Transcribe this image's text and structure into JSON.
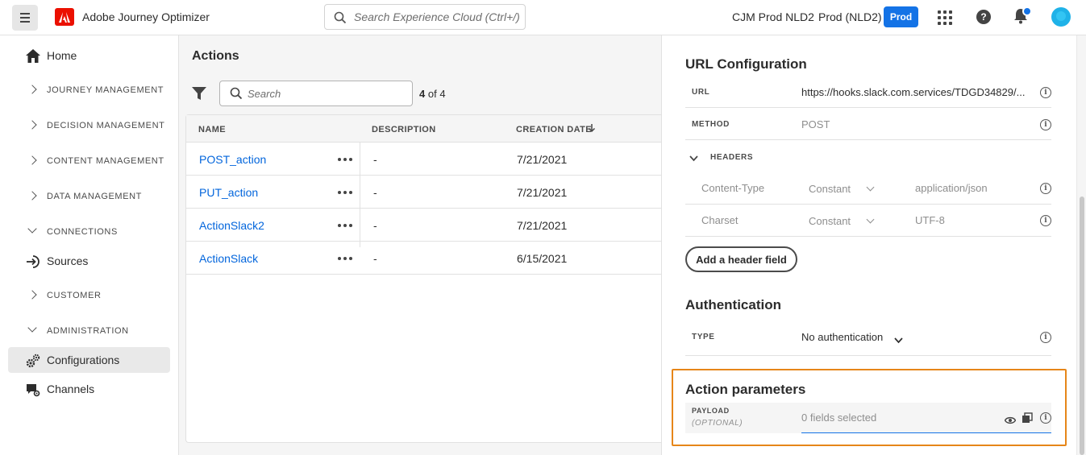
{
  "topbar": {
    "app_title": "Adobe Journey Optimizer",
    "search_placeholder": "Search Experience Cloud (Ctrl+/)",
    "org": "CJM Prod NLD2",
    "sandbox": "Prod (NLD2)",
    "env_badge": "Prod",
    "accent": "#1473e6",
    "brand": "#eb1000",
    "notification_badge": true
  },
  "sidebar": {
    "home": "Home",
    "journey_management": "JOURNEY MANAGEMENT",
    "decision_management": "DECISION MANAGEMENT",
    "content_management": "CONTENT MANAGEMENT",
    "data_management": "DATA MANAGEMENT",
    "connections": "CONNECTIONS",
    "sources": "Sources",
    "customer": "CUSTOMER",
    "administration": "ADMINISTRATION",
    "configurations": "Configurations",
    "channels": "Channels"
  },
  "list": {
    "title": "Actions",
    "search_placeholder": "Search",
    "count_current": "4",
    "count_label": "of 4",
    "columns": {
      "name": "NAME",
      "description": "DESCRIPTION",
      "creation_date": "CREATION DATE"
    },
    "rows": [
      {
        "name": "POST_action",
        "description": "-",
        "date": "7/21/2021"
      },
      {
        "name": "PUT_action",
        "description": "-",
        "date": "7/21/2021"
      },
      {
        "name": "ActionSlack2",
        "description": "-",
        "date": "7/21/2021"
      },
      {
        "name": "ActionSlack",
        "description": "-",
        "date": "6/15/2021"
      }
    ]
  },
  "panel": {
    "url_config_title": "URL Configuration",
    "url_label": "URL",
    "url_value": "https://hooks.slack.com.services/TDGD34829/...",
    "method_label": "METHOD",
    "method_value": "POST",
    "headers_label": "HEADERS",
    "headers": [
      {
        "name": "Content-Type",
        "type": "Constant",
        "value": "application/json"
      },
      {
        "name": "Charset",
        "type": "Constant",
        "value": "UTF-8"
      }
    ],
    "add_header_button": "Add a header field",
    "auth_title": "Authentication",
    "auth_type_label": "TYPE",
    "auth_type_value": "No authentication",
    "params_title": "Action parameters",
    "payload_label": "PAYLOAD",
    "payload_optional": "(OPTIONAL)",
    "payload_value": "0 fields selected",
    "highlight_color": "#e68619"
  }
}
